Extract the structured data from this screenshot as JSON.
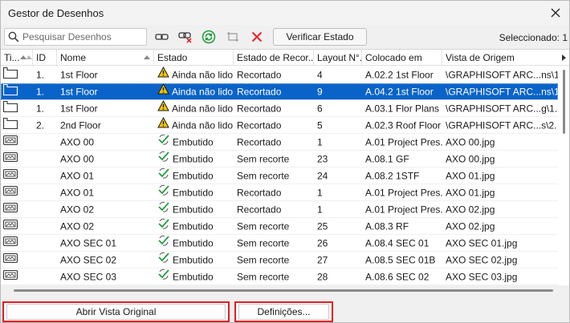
{
  "window": {
    "title": "Gestor de Desenhos"
  },
  "toolbar": {
    "search_placeholder": "Pesquisar Desenhos",
    "verify_label": "Verificar Estado",
    "selected_label": "Seleccionado: 1"
  },
  "columns": {
    "type": "Ti...",
    "id": "ID",
    "name": "Nome",
    "status": "Estado",
    "crop_status": "Estado de Recor...",
    "layout_no": "Layout N°.",
    "placed_in": "Colocado em",
    "source_view": "Vista de Origem"
  },
  "rows": [
    {
      "icon": "folder-view-icon",
      "id": "1.",
      "name": "1st Floor",
      "status_icon": "warning-icon",
      "status": "Ainda não lido",
      "crop": "Recortado",
      "layout": "4",
      "placed": "A.02.2 1st Floor",
      "source": "\\GRAPHISOFT ARC...ns\\1. 1s",
      "selected": false
    },
    {
      "icon": "folder-view-icon",
      "id": "1.",
      "name": "1st Floor",
      "status_icon": "warning-icon",
      "status": "Ainda não lido",
      "crop": "Recortado",
      "layout": "9",
      "placed": "A.04.2 1st Floor",
      "source": "\\GRAPHISOFT ARC...ns\\1. 1s",
      "selected": true
    },
    {
      "icon": "folder-view-icon",
      "id": "1.",
      "name": "1st Floor",
      "status_icon": "warning-icon",
      "status": "Ainda não lido",
      "crop": "Recortado",
      "layout": "6",
      "placed": "A.03.1 Flor Plans",
      "source": "\\GRAPHISOFT ARC...g\\1. 1st",
      "selected": false
    },
    {
      "icon": "folder-view-icon",
      "id": "2.",
      "name": "2nd Floor",
      "status_icon": "warning-icon",
      "status": "Ainda não lido",
      "crop": "Recortado",
      "layout": "5",
      "placed": "A.02.3 Roof Floor",
      "source": "\\GRAPHISOFT ARC...s\\2. 2nd",
      "selected": false
    },
    {
      "icon": "image-file-icon",
      "id": "",
      "name": "AXO 00",
      "status_icon": "embedded-check-icon",
      "status": "Embutido",
      "crop": "Recortado",
      "layout": "1",
      "placed": "A.01 Project Pres...",
      "source": "AXO 00.jpg",
      "selected": false
    },
    {
      "icon": "image-file-icon",
      "id": "",
      "name": "AXO 00",
      "status_icon": "embedded-check-icon",
      "status": "Embutido",
      "crop": "Sem recorte",
      "layout": "23",
      "placed": "A.08.1 GF",
      "source": "AXO 00.jpg",
      "selected": false
    },
    {
      "icon": "image-file-icon",
      "id": "",
      "name": "AXO 01",
      "status_icon": "embedded-check-icon",
      "status": "Embutido",
      "crop": "Sem recorte",
      "layout": "24",
      "placed": "A.08.2 1STF",
      "source": "AXO 01.jpg",
      "selected": false
    },
    {
      "icon": "image-file-icon",
      "id": "",
      "name": "AXO 01",
      "status_icon": "embedded-check-icon",
      "status": "Embutido",
      "crop": "Recortado",
      "layout": "1",
      "placed": "A.01 Project Pres...",
      "source": "AXO 01.jpg",
      "selected": false
    },
    {
      "icon": "image-file-icon",
      "id": "",
      "name": "AXO 02",
      "status_icon": "embedded-check-icon",
      "status": "Embutido",
      "crop": "Recortado",
      "layout": "1",
      "placed": "A.01 Project Pres...",
      "source": "AXO 02.jpg",
      "selected": false
    },
    {
      "icon": "image-file-icon",
      "id": "",
      "name": "AXO 02",
      "status_icon": "embedded-check-icon",
      "status": "Embutido",
      "crop": "Sem recorte",
      "layout": "25",
      "placed": "A.08.3 RF",
      "source": "AXO 02.jpg",
      "selected": false
    },
    {
      "icon": "image-file-icon",
      "id": "",
      "name": "AXO SEC 01",
      "status_icon": "embedded-check-icon",
      "status": "Embutido",
      "crop": "Sem recorte",
      "layout": "26",
      "placed": "A.08.4 SEC 01",
      "source": "AXO SEC 01.jpg",
      "selected": false
    },
    {
      "icon": "image-file-icon",
      "id": "",
      "name": "AXO SEC 02",
      "status_icon": "embedded-check-icon",
      "status": "Embutido",
      "crop": "Sem recorte",
      "layout": "27",
      "placed": "A.08.5 SEC 01B",
      "source": "AXO SEC 02.jpg",
      "selected": false
    },
    {
      "icon": "image-file-icon",
      "id": "",
      "name": "AXO SEC 03",
      "status_icon": "embedded-check-icon",
      "status": "Embutido",
      "crop": "Sem recorte",
      "layout": "28",
      "placed": "A.08.6 SEC 02",
      "source": "AXO SEC 03.jpg",
      "selected": false
    }
  ],
  "buttons": {
    "open_original": "Abrir Vista Original",
    "settings": "Definições..."
  },
  "colors": {
    "selection": "#0a63c8",
    "highlight_border": "#e31b23",
    "warning": "#f5c400",
    "embedded_green": "#1e9b3a",
    "delete_red": "#e8242b"
  }
}
